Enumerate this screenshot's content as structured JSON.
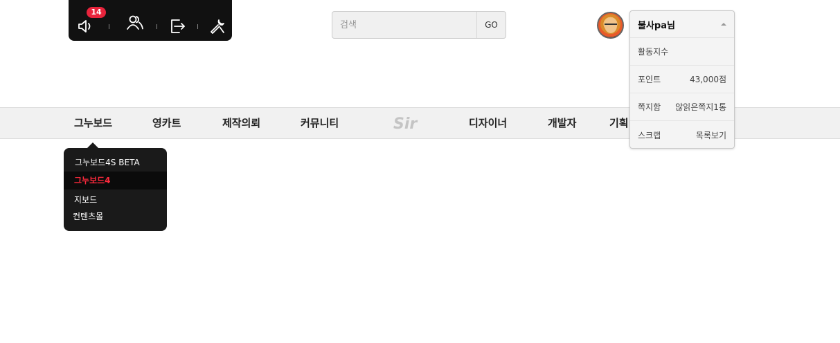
{
  "toolbar": {
    "notifications_count": "14",
    "icons": [
      "speaker-icon",
      "users-icon",
      "logout-icon",
      "tools-icon"
    ]
  },
  "search": {
    "placeholder": "검색",
    "button_label": "GO"
  },
  "user_menu": {
    "username": "불사pa님",
    "rows": [
      {
        "label": "활동지수",
        "value": ""
      },
      {
        "label": "포인트",
        "value": "43,000점"
      },
      {
        "label": "쪽지함",
        "value": "않읽은쪽지1통"
      },
      {
        "label": "스크랩",
        "value": "목록보기"
      }
    ]
  },
  "nav": {
    "items": [
      "그누보드",
      "영카트",
      "제작의뢰",
      "커뮤니티",
      "디자이너",
      "개발자",
      "기획"
    ],
    "logo_text": "Sir"
  },
  "submenu": {
    "items": [
      "그누보드4S BETA",
      "그누보드4",
      "지보드",
      "컨텐츠몰"
    ],
    "active_index": 1
  },
  "colors": {
    "accent_red": "#e8243c",
    "active_sub": "#ff2a3d",
    "dark": "#111111"
  }
}
